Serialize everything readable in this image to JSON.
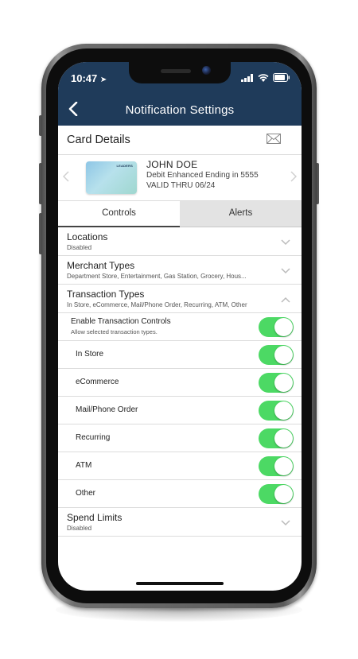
{
  "status_bar": {
    "time": "10:47",
    "location_arrow": "➤"
  },
  "nav": {
    "back_icon": "‹",
    "title": "Notification Settings"
  },
  "card_section": {
    "title": "Card Details",
    "card": {
      "logo_text": "LEADERS",
      "holder_name": "JOHN DOE",
      "description": "Debit Enhanced Ending in 5555",
      "valid_thru": "VALID THRU 06/24"
    }
  },
  "tabs": [
    {
      "label": "Controls",
      "active": true
    },
    {
      "label": "Alerts",
      "active": false
    }
  ],
  "controls": {
    "locations": {
      "title": "Locations",
      "subtitle": "Disabled"
    },
    "merchant_types": {
      "title": "Merchant Types",
      "subtitle": "Department Store, Entertainment, Gas Station, Grocery, Hous..."
    },
    "transaction_types": {
      "title": "Transaction Types",
      "subtitle": "In Store, eCommerce, Mail/Phone Order, Recurring, ATM, Other",
      "enable": {
        "title": "Enable Transaction Controls",
        "subtitle": "Allow selected transaction types.",
        "on": true
      },
      "items": [
        {
          "label": "In Store",
          "on": true
        },
        {
          "label": "eCommerce",
          "on": true
        },
        {
          "label": "Mail/Phone Order",
          "on": true
        },
        {
          "label": "Recurring",
          "on": true
        },
        {
          "label": "ATM",
          "on": true
        },
        {
          "label": "Other",
          "on": true
        }
      ]
    },
    "spend_limits": {
      "title": "Spend Limits",
      "subtitle": "Disabled"
    }
  },
  "colors": {
    "nav_bg": "#1f3b5a",
    "toggle_on": "#4cd964"
  }
}
